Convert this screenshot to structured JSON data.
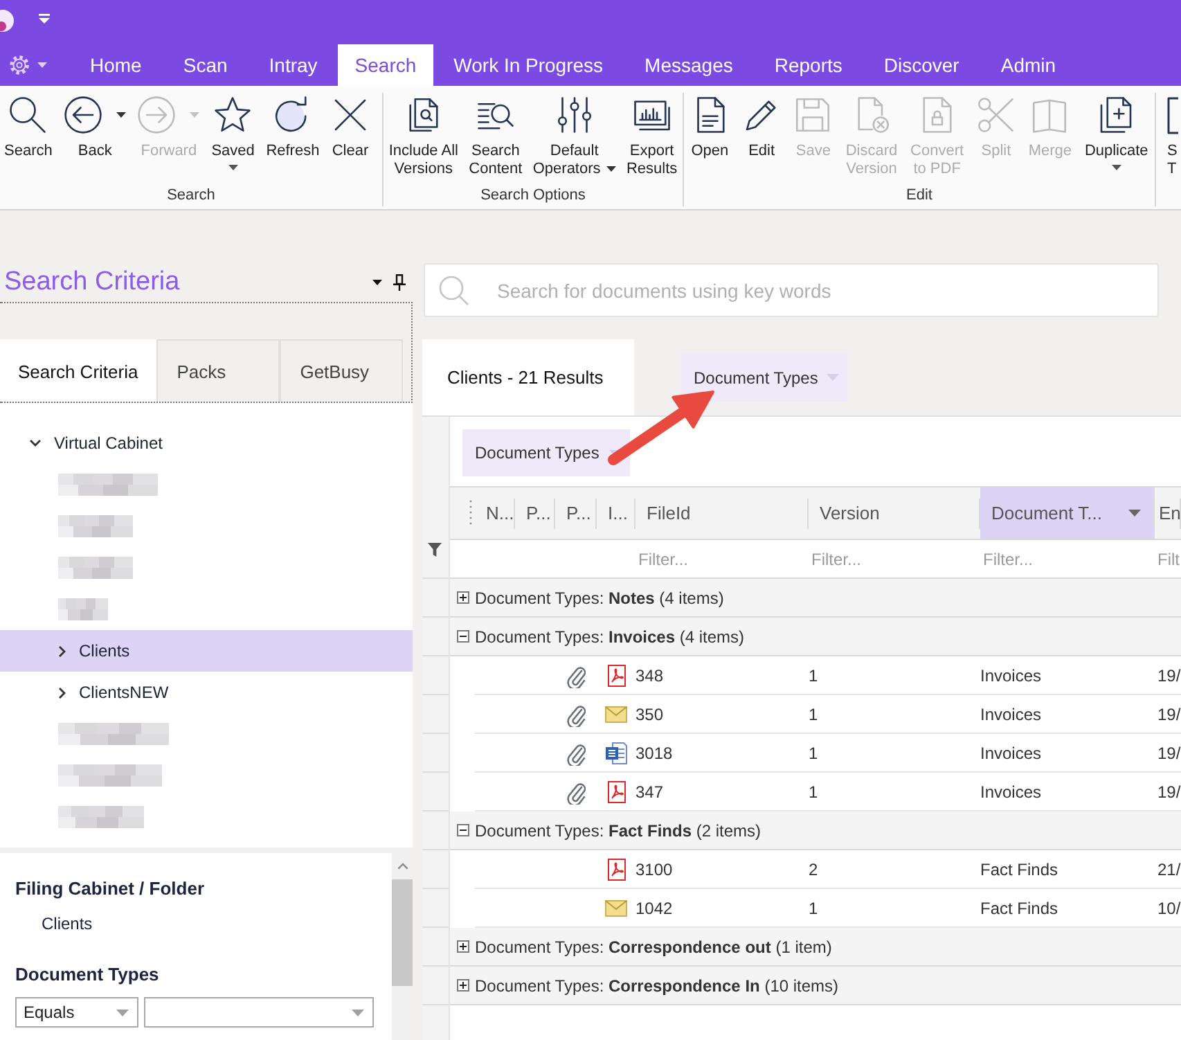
{
  "nav": {
    "tabs": [
      {
        "label": "Home",
        "selected": false
      },
      {
        "label": "Scan",
        "selected": false
      },
      {
        "label": "Intray",
        "selected": false
      },
      {
        "label": "Search",
        "selected": true
      },
      {
        "label": "Work In Progress",
        "selected": false
      },
      {
        "label": "Messages",
        "selected": false
      },
      {
        "label": "Reports",
        "selected": false
      },
      {
        "label": "Discover",
        "selected": false
      },
      {
        "label": "Admin",
        "selected": false
      }
    ]
  },
  "ribbon": {
    "groups": [
      {
        "label": "Search",
        "buttons": [
          {
            "kind": "plain",
            "label": "Search",
            "disabled": false
          },
          {
            "kind": "split",
            "label": "Back",
            "disabled": false
          },
          {
            "kind": "split",
            "label": "Forward",
            "disabled": true
          },
          {
            "kind": "dropdown",
            "label": "Saved",
            "disabled": false
          },
          {
            "kind": "plain",
            "label": "Refresh",
            "disabled": false
          },
          {
            "kind": "plain",
            "label": "Clear",
            "disabled": false
          }
        ]
      },
      {
        "label": "Search Options",
        "buttons": [
          {
            "kind": "plain",
            "label": "Include All\nVersions",
            "disabled": false
          },
          {
            "kind": "plain",
            "label": "Search\nContent",
            "disabled": false
          },
          {
            "kind": "dropdown_inline",
            "label": "Default\nOperators",
            "disabled": false
          },
          {
            "kind": "plain",
            "label": "Export\nResults",
            "disabled": false
          }
        ]
      },
      {
        "label": "Edit",
        "buttons": [
          {
            "kind": "plain",
            "label": "Open",
            "disabled": false
          },
          {
            "kind": "plain",
            "label": "Edit",
            "disabled": false
          },
          {
            "kind": "plain",
            "label": "Save",
            "disabled": true
          },
          {
            "kind": "plain",
            "label": "Discard\nVersion",
            "disabled": true
          },
          {
            "kind": "plain",
            "label": "Convert\nto PDF",
            "disabled": true
          },
          {
            "kind": "plain",
            "label": "Split",
            "disabled": true
          },
          {
            "kind": "plain",
            "label": "Merge",
            "disabled": true
          },
          {
            "kind": "dropdown",
            "label": "Duplicate",
            "disabled": false
          }
        ]
      },
      {
        "buttons": [
          {
            "kind": "plain",
            "label": "S\nT",
            "disabled": false
          }
        ]
      }
    ]
  },
  "criteria_panel": {
    "title": "Search Criteria",
    "tabs": [
      {
        "label": "Search Criteria",
        "selected": true
      },
      {
        "label": "Packs",
        "selected": false
      },
      {
        "label": "GetBusy",
        "selected": false
      }
    ],
    "tree": [
      {
        "kind": "folder",
        "label": "Virtual Cabinet",
        "selected": false,
        "expanded": true,
        "children": [
          {
            "kind": "blurred",
            "selected": false
          },
          {
            "kind": "blurred",
            "selected": false
          },
          {
            "kind": "blurred",
            "selected": false
          },
          {
            "kind": "blurred",
            "selected": false
          },
          {
            "kind": "folder",
            "label": "Clients",
            "selected": true,
            "expanded": false
          },
          {
            "kind": "folder",
            "label": "ClientsNEW",
            "selected": false,
            "expanded": false
          },
          {
            "kind": "blurred",
            "selected": false
          },
          {
            "kind": "blurred",
            "selected": false
          },
          {
            "kind": "blurred",
            "selected": false
          }
        ]
      }
    ],
    "criteria": [
      {
        "kind": "value",
        "heading": "Filing Cabinet / Folder",
        "value": "Clients"
      },
      {
        "kind": "select",
        "heading": "Document Types",
        "operator": "Equals"
      }
    ]
  },
  "search_bar": {
    "placeholder": "Search for documents using key words"
  },
  "results": {
    "tabs": [
      {
        "label": "Clients - 21 Results",
        "selected": true
      }
    ],
    "dragged_chip": {
      "label": "Document Types"
    },
    "annotations": [
      {
        "kind": "arrow"
      }
    ],
    "group_by": [
      {
        "label": "Document Types"
      }
    ],
    "columns": [
      {
        "label": "N...",
        "grouped": false
      },
      {
        "label": "P...",
        "grouped": false
      },
      {
        "label": "P...",
        "grouped": false
      },
      {
        "label": "I...",
        "grouped": false
      },
      {
        "label": "FileId",
        "grouped": false,
        "filter_placeholder": "Filter..."
      },
      {
        "label": "Version",
        "grouped": false,
        "filter_placeholder": "Filter..."
      },
      {
        "label": "Document T...",
        "grouped": true,
        "filter_placeholder": "Filter..."
      },
      {
        "label": "En",
        "grouped": false,
        "filter_placeholder": "Filt"
      }
    ],
    "groups": [
      {
        "title": "Document Types: **Notes** (4 items)",
        "expanded": false
      },
      {
        "title": "Document Types: **Invoices** (4 items)",
        "expanded": true,
        "rows": [
          {
            "attachment": true,
            "kind": "pdf",
            "cells": [
              "348",
              "1",
              "Invoices",
              "19/"
            ]
          },
          {
            "attachment": true,
            "kind": "email",
            "cells": [
              "350",
              "1",
              "Invoices",
              "19/"
            ]
          },
          {
            "attachment": true,
            "kind": "word",
            "cells": [
              "3018",
              "1",
              "Invoices",
              "19/"
            ]
          },
          {
            "attachment": true,
            "kind": "pdf",
            "cells": [
              "347",
              "1",
              "Invoices",
              "19/"
            ]
          }
        ]
      },
      {
        "title": "Document Types: **Fact Finds** (2 items)",
        "expanded": true,
        "rows": [
          {
            "attachment": false,
            "kind": "pdf",
            "cells": [
              "3100",
              "2",
              "Fact Finds",
              "21/"
            ]
          },
          {
            "attachment": false,
            "kind": "email",
            "cells": [
              "1042",
              "1",
              "Fact Finds",
              "10/"
            ]
          }
        ]
      },
      {
        "title": "Document Types: **Correspondence out** (1 item)",
        "expanded": false
      },
      {
        "title": "Document Types: **Correspondence In** (10 items)",
        "expanded": false
      }
    ]
  }
}
